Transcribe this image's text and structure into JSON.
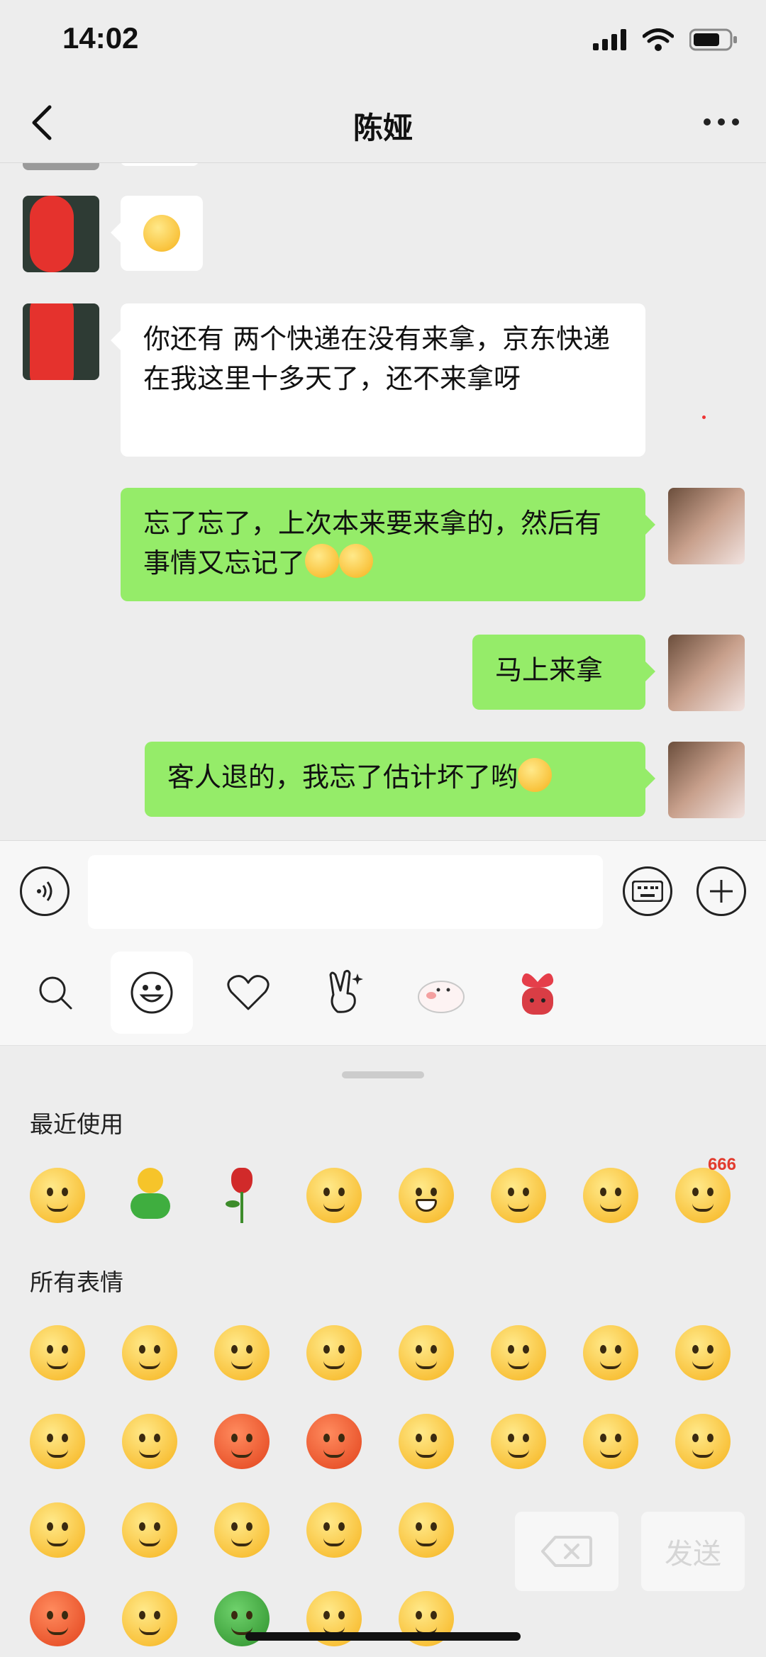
{
  "status_bar": {
    "time": "14:02"
  },
  "header": {
    "title": "陈娅"
  },
  "messages": [
    {
      "side": "left",
      "text": "",
      "has_emoji": true
    },
    {
      "side": "left",
      "text": "你还有 两个快递在没有来拿，京东快递在我这里十多天了，还不来拿呀"
    },
    {
      "side": "right",
      "text": "忘了忘了，上次本来要来拿的，然后有事情又忘记了"
    },
    {
      "side": "right",
      "text": "马上来拿"
    },
    {
      "side": "right",
      "text": "客人退的，我忘了估计坏了哟"
    }
  ],
  "input": {
    "placeholder": ""
  },
  "emoji_panel": {
    "recent_label": "最近使用",
    "all_label": "所有表情",
    "sticker_badge": "666",
    "send_label": "发送"
  },
  "colors": {
    "bubble_right": "#95ec69",
    "bubble_left": "#ffffff",
    "background": "#ededed"
  }
}
